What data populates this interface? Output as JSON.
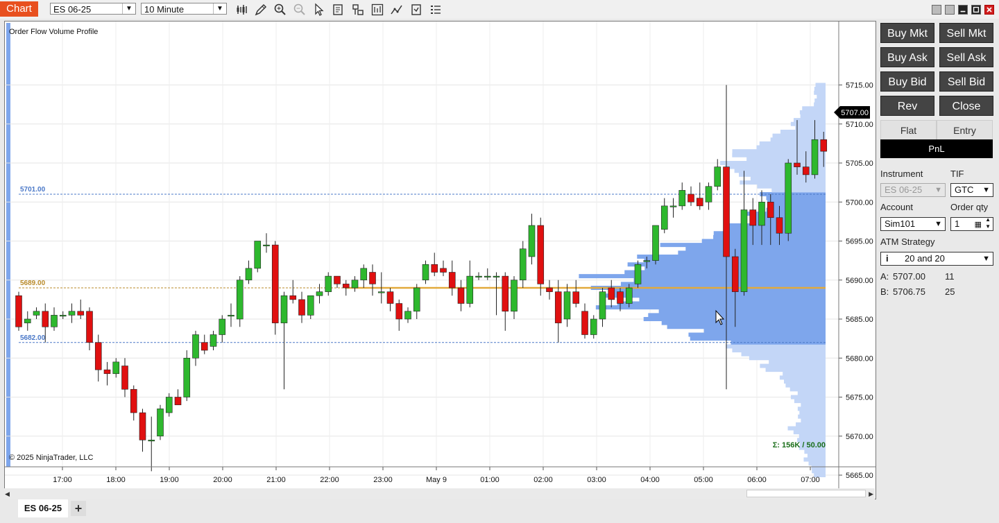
{
  "toolbar": {
    "chart_label": "Chart",
    "instrument_value": "ES 06-25",
    "interval_value": "10 Minute"
  },
  "chart": {
    "indicator_label": "Order Flow Volume Profile",
    "copyright": "© 2025 NinjaTrader, LLC",
    "profile_summary": "Σ: 156K / 50.00",
    "current_price_label": "5707.00",
    "levels": [
      {
        "label": "5701.00",
        "price": 5701.0,
        "color": "#4a78c8"
      },
      {
        "label": "5689.00",
        "price": 5689.0,
        "color": "#b98a2a"
      },
      {
        "label": "5682.00",
        "price": 5682.0,
        "color": "#4a78c8"
      }
    ],
    "colors": {
      "up": "#2eb82e",
      "down": "#e01010",
      "value_area": "#7ea6ec",
      "profile": "#c3d6f7",
      "poc": "#e2a93b"
    }
  },
  "chart_data": {
    "type": "candlestick",
    "title": "Order Flow Volume Profile",
    "ylim": [
      5663,
      5717
    ],
    "y_ticks": [
      "5715.00",
      "5710.00",
      "5705.00",
      "5700.00",
      "5695.00",
      "5690.00",
      "5685.00",
      "5680.00",
      "5675.00",
      "5670.00",
      "5665.00"
    ],
    "x_ticks": [
      "17:00",
      "18:00",
      "19:00",
      "20:00",
      "21:00",
      "22:00",
      "23:00",
      "May 9",
      "01:00",
      "02:00",
      "03:00",
      "04:00",
      "05:00",
      "06:00",
      "07:00"
    ],
    "candles": [
      {
        "o": 5688.0,
        "h": 5688.5,
        "l": 5683.5,
        "c": 5684.0
      },
      {
        "o": 5684.5,
        "h": 5686.0,
        "l": 5683.5,
        "c": 5685.0
      },
      {
        "o": 5685.5,
        "h": 5686.5,
        "l": 5685.0,
        "c": 5686.0
      },
      {
        "o": 5686.0,
        "h": 5687.0,
        "l": 5682.0,
        "c": 5684.0
      },
      {
        "o": 5684.0,
        "h": 5686.5,
        "l": 5683.5,
        "c": 5685.5
      },
      {
        "o": 5685.5,
        "h": 5686.0,
        "l": 5685.0,
        "c": 5685.5
      },
      {
        "o": 5685.5,
        "h": 5687.0,
        "l": 5684.5,
        "c": 5686.0
      },
      {
        "o": 5686.0,
        "h": 5687.5,
        "l": 5685.0,
        "c": 5685.5
      },
      {
        "o": 5686.0,
        "h": 5686.5,
        "l": 5681.0,
        "c": 5682.0
      },
      {
        "o": 5682.0,
        "h": 5683.0,
        "l": 5677.0,
        "c": 5678.5
      },
      {
        "o": 5678.5,
        "h": 5679.5,
        "l": 5676.5,
        "c": 5678.0
      },
      {
        "o": 5678.0,
        "h": 5680.0,
        "l": 5677.5,
        "c": 5679.5
      },
      {
        "o": 5679.0,
        "h": 5680.0,
        "l": 5675.0,
        "c": 5676.0
      },
      {
        "o": 5676.0,
        "h": 5676.5,
        "l": 5672.0,
        "c": 5673.0
      },
      {
        "o": 5673.0,
        "h": 5673.5,
        "l": 5668.0,
        "c": 5669.5
      },
      {
        "o": 5669.5,
        "h": 5672.5,
        "l": 5665.5,
        "c": 5669.5
      },
      {
        "o": 5670.0,
        "h": 5674.0,
        "l": 5669.5,
        "c": 5673.5
      },
      {
        "o": 5673.0,
        "h": 5675.5,
        "l": 5672.5,
        "c": 5675.0
      },
      {
        "o": 5675.0,
        "h": 5676.0,
        "l": 5674.5,
        "c": 5674.0
      },
      {
        "o": 5675.0,
        "h": 5681.0,
        "l": 5674.5,
        "c": 5680.0
      },
      {
        "o": 5680.0,
        "h": 5683.5,
        "l": 5679.0,
        "c": 5683.0
      },
      {
        "o": 5682.0,
        "h": 5683.0,
        "l": 5680.5,
        "c": 5681.0
      },
      {
        "o": 5681.5,
        "h": 5683.5,
        "l": 5681.0,
        "c": 5683.0
      },
      {
        "o": 5683.0,
        "h": 5685.5,
        "l": 5682.0,
        "c": 5685.0
      },
      {
        "o": 5685.5,
        "h": 5687.0,
        "l": 5684.0,
        "c": 5685.5
      },
      {
        "o": 5685.0,
        "h": 5690.5,
        "l": 5684.0,
        "c": 5690.0
      },
      {
        "o": 5690.0,
        "h": 5692.5,
        "l": 5689.5,
        "c": 5691.5
      },
      {
        "o": 5691.5,
        "h": 5695.0,
        "l": 5691.0,
        "c": 5695.0
      },
      {
        "o": 5694.5,
        "h": 5696.0,
        "l": 5693.5,
        "c": 5694.5
      },
      {
        "o": 5694.5,
        "h": 5695.0,
        "l": 5683.0,
        "c": 5684.5
      },
      {
        "o": 5684.5,
        "h": 5688.5,
        "l": 5676.0,
        "c": 5688.0
      },
      {
        "o": 5688.0,
        "h": 5690.0,
        "l": 5687.0,
        "c": 5687.5
      },
      {
        "o": 5687.5,
        "h": 5688.5,
        "l": 5684.5,
        "c": 5685.5
      },
      {
        "o": 5685.5,
        "h": 5688.0,
        "l": 5685.0,
        "c": 5688.0
      },
      {
        "o": 5688.0,
        "h": 5689.5,
        "l": 5687.0,
        "c": 5688.5
      },
      {
        "o": 5688.5,
        "h": 5691.0,
        "l": 5688.0,
        "c": 5690.5
      },
      {
        "o": 5690.5,
        "h": 5690.0,
        "l": 5689.0,
        "c": 5689.5
      },
      {
        "o": 5689.5,
        "h": 5690.0,
        "l": 5688.0,
        "c": 5689.0
      },
      {
        "o": 5689.0,
        "h": 5690.5,
        "l": 5688.5,
        "c": 5690.0
      },
      {
        "o": 5690.0,
        "h": 5692.0,
        "l": 5689.0,
        "c": 5691.5
      },
      {
        "o": 5691.0,
        "h": 5692.0,
        "l": 5688.0,
        "c": 5689.5
      },
      {
        "o": 5688.5,
        "h": 5691.0,
        "l": 5687.0,
        "c": 5688.5
      },
      {
        "o": 5688.5,
        "h": 5689.0,
        "l": 5686.0,
        "c": 5687.0
      },
      {
        "o": 5687.0,
        "h": 5687.5,
        "l": 5683.5,
        "c": 5685.0
      },
      {
        "o": 5685.0,
        "h": 5686.5,
        "l": 5684.5,
        "c": 5686.0
      },
      {
        "o": 5686.0,
        "h": 5689.5,
        "l": 5685.0,
        "c": 5689.0
      },
      {
        "o": 5690.0,
        "h": 5692.5,
        "l": 5689.5,
        "c": 5692.0
      },
      {
        "o": 5692.0,
        "h": 5693.5,
        "l": 5690.5,
        "c": 5691.0
      },
      {
        "o": 5691.5,
        "h": 5692.5,
        "l": 5690.5,
        "c": 5691.0
      },
      {
        "o": 5691.0,
        "h": 5692.5,
        "l": 5688.0,
        "c": 5689.0
      },
      {
        "o": 5689.0,
        "h": 5690.0,
        "l": 5686.0,
        "c": 5687.0
      },
      {
        "o": 5687.0,
        "h": 5692.5,
        "l": 5686.5,
        "c": 5690.5
      },
      {
        "o": 5690.5,
        "h": 5691.0,
        "l": 5690.0,
        "c": 5690.5
      },
      {
        "o": 5690.5,
        "h": 5691.5,
        "l": 5690.0,
        "c": 5690.5
      },
      {
        "o": 5690.5,
        "h": 5691.0,
        "l": 5685.5,
        "c": 5690.5
      },
      {
        "o": 5690.5,
        "h": 5691.0,
        "l": 5683.5,
        "c": 5686.0
      },
      {
        "o": 5686.0,
        "h": 5690.5,
        "l": 5685.0,
        "c": 5690.0
      },
      {
        "o": 5690.0,
        "h": 5695.0,
        "l": 5689.0,
        "c": 5694.0
      },
      {
        "o": 5693.0,
        "h": 5698.5,
        "l": 5692.0,
        "c": 5697.0
      },
      {
        "o": 5697.0,
        "h": 5698.0,
        "l": 5688.0,
        "c": 5689.5
      },
      {
        "o": 5689.0,
        "h": 5690.0,
        "l": 5687.5,
        "c": 5688.5
      },
      {
        "o": 5688.5,
        "h": 5690.0,
        "l": 5682.0,
        "c": 5684.5
      },
      {
        "o": 5685.0,
        "h": 5689.5,
        "l": 5684.0,
        "c": 5688.5
      },
      {
        "o": 5688.5,
        "h": 5690.0,
        "l": 5686.5,
        "c": 5687.0
      },
      {
        "o": 5686.0,
        "h": 5687.0,
        "l": 5682.5,
        "c": 5683.0
      },
      {
        "o": 5683.0,
        "h": 5685.5,
        "l": 5682.5,
        "c": 5685.0
      },
      {
        "o": 5685.0,
        "h": 5689.0,
        "l": 5684.0,
        "c": 5688.5
      },
      {
        "o": 5689.0,
        "h": 5690.0,
        "l": 5686.5,
        "c": 5687.5
      },
      {
        "o": 5688.5,
        "h": 5689.0,
        "l": 5686.0,
        "c": 5687.0
      },
      {
        "o": 5687.0,
        "h": 5689.5,
        "l": 5686.5,
        "c": 5689.0
      },
      {
        "o": 5689.5,
        "h": 5692.5,
        "l": 5689.0,
        "c": 5692.0
      },
      {
        "o": 5692.5,
        "h": 5693.0,
        "l": 5691.5,
        "c": 5692.5
      },
      {
        "o": 5692.5,
        "h": 5697.0,
        "l": 5692.0,
        "c": 5697.0
      },
      {
        "o": 5696.5,
        "h": 5700.5,
        "l": 5696.0,
        "c": 5699.5
      },
      {
        "o": 5699.5,
        "h": 5700.5,
        "l": 5698.0,
        "c": 5699.5
      },
      {
        "o": 5699.5,
        "h": 5702.5,
        "l": 5699.0,
        "c": 5701.5
      },
      {
        "o": 5701.0,
        "h": 5702.0,
        "l": 5699.5,
        "c": 5700.0
      },
      {
        "o": 5700.5,
        "h": 5702.5,
        "l": 5699.0,
        "c": 5699.5
      },
      {
        "o": 5700.0,
        "h": 5702.5,
        "l": 5699.0,
        "c": 5702.0
      },
      {
        "o": 5702.0,
        "h": 5705.5,
        "l": 5701.5,
        "c": 5704.5
      },
      {
        "o": 5704.5,
        "h": 5715.0,
        "l": 5676.0,
        "c": 5693.0
      },
      {
        "o": 5693.0,
        "h": 5694.0,
        "l": 5684.0,
        "c": 5688.5
      },
      {
        "o": 5688.5,
        "h": 5704.0,
        "l": 5688.0,
        "c": 5699.0
      },
      {
        "o": 5699.0,
        "h": 5700.5,
        "l": 5694.5,
        "c": 5697.0
      },
      {
        "o": 5697.0,
        "h": 5701.5,
        "l": 5694.5,
        "c": 5700.0
      },
      {
        "o": 5700.0,
        "h": 5701.0,
        "l": 5694.5,
        "c": 5698.0
      },
      {
        "o": 5698.0,
        "h": 5699.5,
        "l": 5694.5,
        "c": 5696.0
      },
      {
        "o": 5696.0,
        "h": 5705.5,
        "l": 5695.0,
        "c": 5705.0
      },
      {
        "o": 5705.0,
        "h": 5710.5,
        "l": 5703.5,
        "c": 5704.5
      },
      {
        "o": 5704.5,
        "h": 5706.5,
        "l": 5702.5,
        "c": 5703.5
      },
      {
        "o": 5703.5,
        "h": 5710.5,
        "l": 5703.0,
        "c": 5708.0
      },
      {
        "o": 5708.0,
        "h": 5709.0,
        "l": 5704.5,
        "c": 5706.5
      }
    ]
  },
  "panel": {
    "buttons": [
      "Buy Mkt",
      "Sell Mkt",
      "Buy Ask",
      "Sell Ask",
      "Buy Bid",
      "Sell Bid",
      "Rev",
      "Close"
    ],
    "flat": "Flat",
    "entry": "Entry",
    "pnl": "PnL",
    "instrument_label": "Instrument",
    "instrument_value": "ES 06-25",
    "tif_label": "TIF",
    "tif_value": "GTC",
    "account_label": "Account",
    "account_value": "Sim101",
    "qty_label": "Order qty",
    "qty_value": "1",
    "atm_label": "ATM Strategy",
    "atm_value": "20 and 20",
    "ask_label": "A:",
    "ask_price": "5707.00",
    "ask_size": "11",
    "bid_label": "B:",
    "bid_price": "5706.75",
    "bid_size": "25"
  },
  "tabs": {
    "active": "ES 06-25",
    "add": "+"
  }
}
